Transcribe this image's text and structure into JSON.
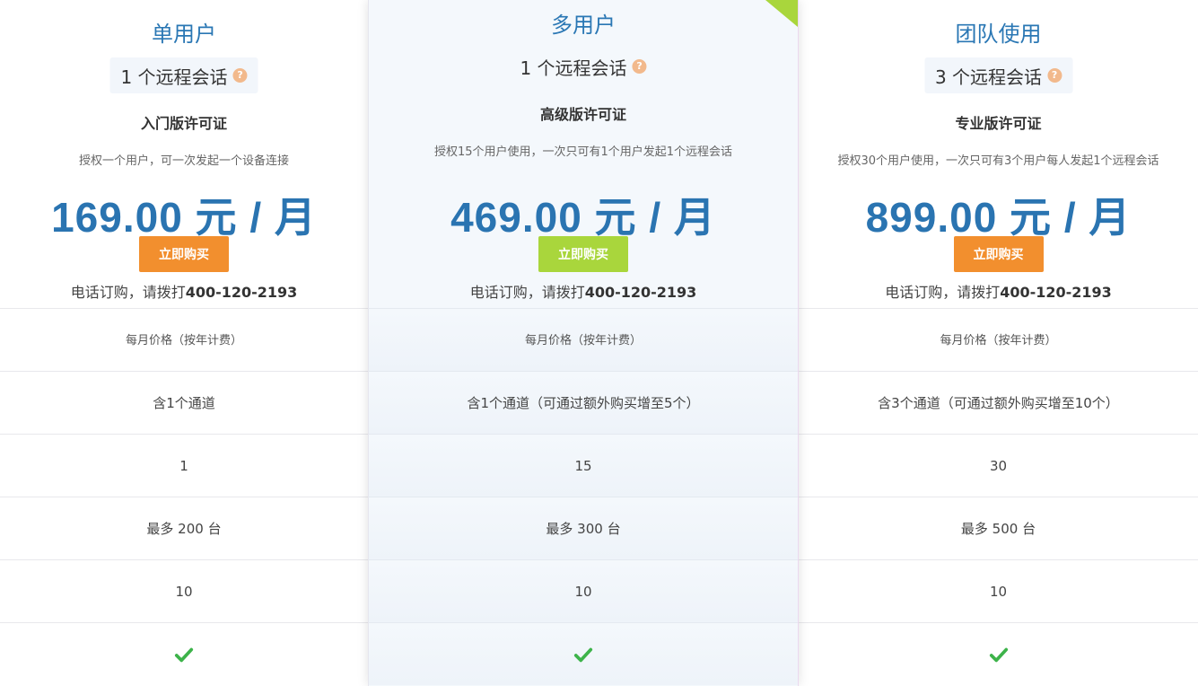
{
  "plans": [
    {
      "title": "单用户",
      "sessions": "1 个远程会话",
      "license": "入门版许可证",
      "desc": "授权一个用户，可一次发起一个设备连接",
      "price": "169.00 元 / 月",
      "buy_label": "立即购买",
      "phone_prefix": "电话订购，请拨打",
      "phone_number": "400-120-2193",
      "rows": [
        "每月价格（按年计费）",
        "含1个通道",
        "1",
        "最多 200 台",
        "10"
      ]
    },
    {
      "title": "多用户",
      "sessions": "1 个远程会话",
      "license": "高级版许可证",
      "desc": "授权15个用户使用，一次只可有1个用户发起1个远程会话",
      "price": "469.00 元 / 月",
      "buy_label": "立即购买",
      "phone_prefix": "电话订购，请拨打",
      "phone_number": "400-120-2193",
      "rows": [
        "每月价格（按年计费）",
        "含1个通道（可通过额外购买增至5个）",
        "15",
        "最多 300 台",
        "10"
      ]
    },
    {
      "title": "团队使用",
      "sessions": "3 个远程会话",
      "license": "专业版许可证",
      "desc": "授权30个用户使用，一次只可有3个用户每人发起1个远程会话",
      "price": "899.00 元 / 月",
      "buy_label": "立即购买",
      "phone_prefix": "电话订购，请拨打",
      "phone_number": "400-120-2193",
      "rows": [
        "每月价格（按年计费）",
        "含3个通道（可通过额外购买增至10个）",
        "30",
        "最多 500 台",
        "10"
      ]
    }
  ],
  "help_glyph": "?",
  "colors": {
    "title_blue": "#2a77b4",
    "price_blue": "#2a74b1",
    "buy_orange": "#f28f2e",
    "buy_green": "#a9d63c",
    "check_green": "#3db34a",
    "help_orange": "#f2b98c"
  },
  "icons": {
    "check": "check-icon",
    "help": "help-icon"
  }
}
